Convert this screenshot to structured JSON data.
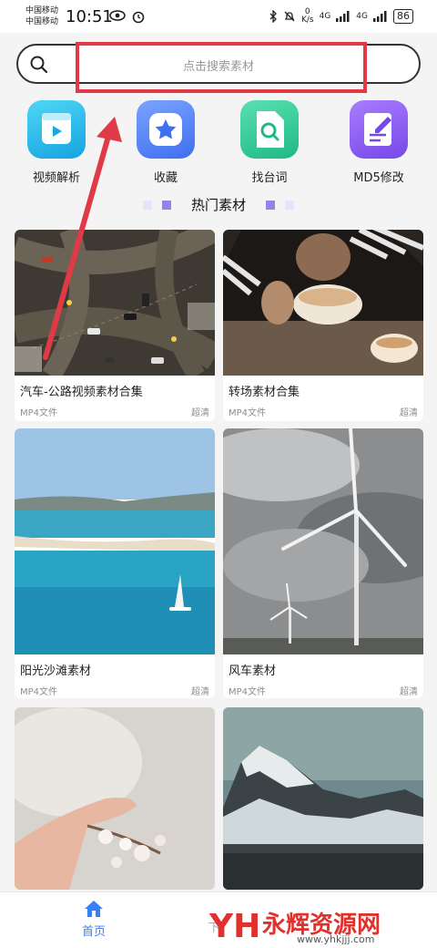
{
  "status_bar": {
    "carrier_1": "中国移动",
    "carrier_2": "中国移动",
    "time": "10:51",
    "speed_value": "0",
    "speed_unit": "K/s",
    "net_1": "4G",
    "net_2": "4G",
    "battery": "86"
  },
  "search": {
    "placeholder": "点击搜索素材"
  },
  "quick_actions": [
    {
      "label": "视频解析",
      "icon": "video-parse-icon",
      "color": "#21b6e8"
    },
    {
      "label": "收藏",
      "icon": "star-favorite-icon",
      "color": "#4f7cf0"
    },
    {
      "label": "找台词",
      "icon": "search-document-icon",
      "color": "#2fc69b"
    },
    {
      "label": "MD5修改",
      "icon": "edit-document-icon",
      "color": "#8b5cf0"
    }
  ],
  "section": {
    "title": "热门素材"
  },
  "materials": [
    {
      "name": "汽车-公路视频素材合集",
      "format": "MP4文件",
      "quality": "超清",
      "thumb": "aerial-road-night"
    },
    {
      "name": "转场素材合集",
      "format": "MP4文件",
      "quality": "超清",
      "thumb": "eating-bowl"
    },
    {
      "name": "阳光沙滩素材",
      "format": "MP4文件",
      "quality": "超清",
      "thumb": "beach-sea"
    },
    {
      "name": "风车素材",
      "format": "MP4文件",
      "quality": "超清",
      "thumb": "wind-turbines"
    },
    {
      "name": "",
      "format": "",
      "quality": "",
      "thumb": "hand-blossom"
    },
    {
      "name": "",
      "format": "",
      "quality": "",
      "thumb": "snow-mountain"
    }
  ],
  "bottom_nav": {
    "home_label": "首页",
    "second_label": "下"
  },
  "watermark": {
    "logo": "YH",
    "text": "永辉资源网",
    "url": "www.yhkjjj.com"
  },
  "colors": {
    "accent": "#3b7ff7",
    "highlight": "#e03a46"
  }
}
